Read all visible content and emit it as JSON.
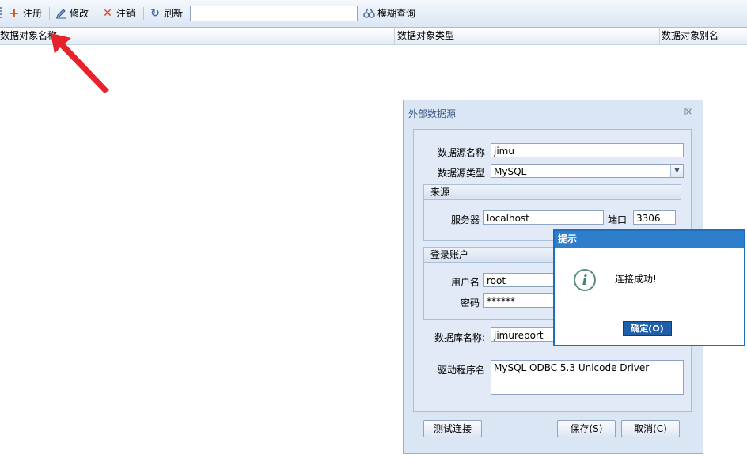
{
  "toolbar": {
    "register": "注册",
    "modify": "修改",
    "unregister": "注销",
    "refresh": "刷新",
    "search_value": "",
    "fuzzy_search": "模糊查询"
  },
  "grid": {
    "columns": [
      "数据对象名称",
      "数据对象类型",
      "数据对象别名"
    ]
  },
  "dialog": {
    "title": "外部数据源",
    "close": "☒",
    "fields": {
      "name_label": "数据源名称",
      "name_value": "jimu",
      "type_label": "数据源类型",
      "type_value": "MySQL"
    },
    "source_group": {
      "title": "来源",
      "server_label": "服务器",
      "server_value": "localhost",
      "port_label": "端口",
      "port_value": "3306"
    },
    "login_group": {
      "title": "登录账户",
      "user_label": "用户名",
      "user_value": "root",
      "password_label": "密码",
      "password_value": "******"
    },
    "db_label": "数据库名称:",
    "db_value": "jimureport",
    "driver_label": "驱动程序名",
    "driver_value": "MySQL ODBC 5.3 Unicode Driver",
    "test_button": "测试连接",
    "save_button": "保存(S)",
    "cancel_button": "取消(C)"
  },
  "message": {
    "title": "提示",
    "text": "连接成功!",
    "ok": "确定(O)"
  },
  "colors": {
    "accent": "#2d7fcc",
    "arrow": "#e8222a"
  }
}
